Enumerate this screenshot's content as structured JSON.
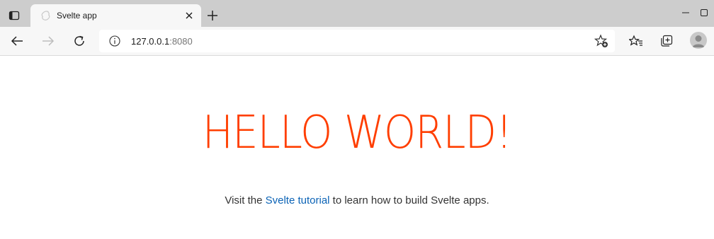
{
  "browser": {
    "tab": {
      "title": "Svelte app"
    },
    "address": {
      "host": "127.0.0.1",
      "port": ":8080"
    }
  },
  "icons": {
    "tab_actions": "tab-actions-icon",
    "favicon": "svelte-favicon",
    "close": "close-icon",
    "new_tab": "plus-icon",
    "back": "arrow-left-icon",
    "forward": "arrow-right-icon",
    "refresh": "refresh-icon",
    "info": "info-icon",
    "add_favorite": "star-plus-icon",
    "favorites": "favorites-icon",
    "collections": "collections-icon",
    "profile": "profile-avatar",
    "minimize": "minimize-icon",
    "maximize": "maximize-icon"
  },
  "page": {
    "heading": "HELLO WORLD!",
    "text_before": "Visit the ",
    "link_text": "Svelte tutorial",
    "text_after": " to learn how to build Svelte apps."
  },
  "colors": {
    "heading": "#ff3e00",
    "link": "#0b63b6",
    "tabstrip": "#cdcdcd",
    "toolbar": "#f7f7f7"
  }
}
